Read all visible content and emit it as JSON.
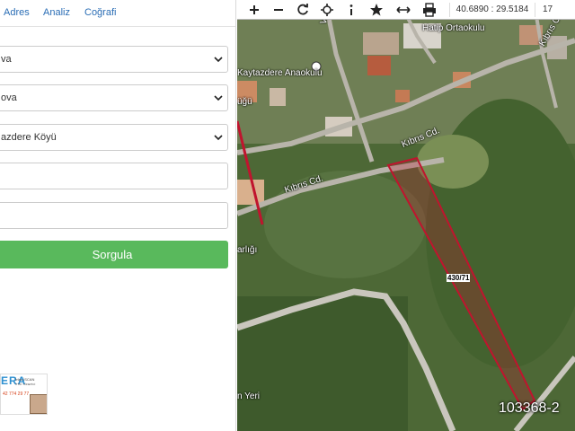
{
  "tabs": {
    "adres": "Adres",
    "analiz": "Analiz",
    "cografi": "Coğrafi"
  },
  "fields": {
    "il": "va",
    "ilce": "ova",
    "mahalle": "azdere Köyü",
    "ada": "",
    "parsel": ""
  },
  "button": {
    "sorgula": "Sorgula"
  },
  "ad": {
    "logo": "ERA",
    "name": "İrfan İSCAN",
    "title": "İTTİK YÖNETİCİ",
    "phone": "42 774 29 77"
  },
  "toolbar": {
    "coords": "40.6890 : 29.5184",
    "zoom": "17",
    "icons": [
      "plus-icon",
      "minus-icon",
      "refresh-icon",
      "crosshair-icon",
      "info-icon",
      "star-icon",
      "measure-icon",
      "print-icon"
    ]
  },
  "map_labels": {
    "school": "Hatip Ortaokulu",
    "kindergarten": "Kaytazdere Anaokulu",
    "street_kibris_1": "Kıbrıs Cd.",
    "street_kibris_2": "Kıbrıs Cd.",
    "street_kibris_3": "Kıbrıs Cd.",
    "partial_ugu": "üğü",
    "partial_arligi": "arlığı",
    "partial_yeri": "n Yeri",
    "partial_va": "Va",
    "parcel": "430/71",
    "reference": "103368-2"
  },
  "colors": {
    "accent": "#2a6db5",
    "button": "#59b95c",
    "parcel": "#c0142e"
  }
}
